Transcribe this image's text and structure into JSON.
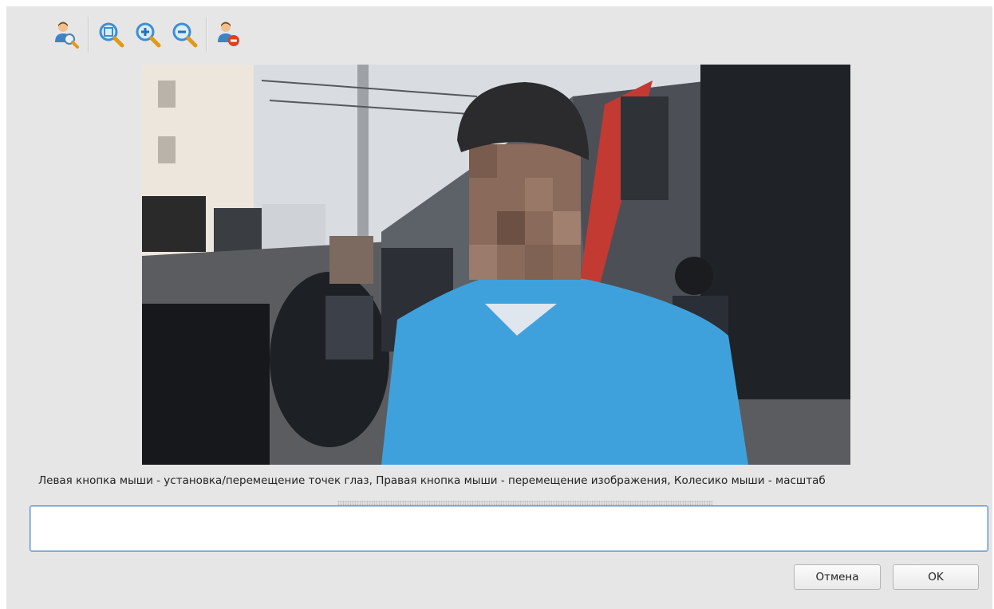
{
  "toolbar": {
    "buttons": [
      {
        "icon": "person-search-icon",
        "tooltip": ""
      },
      {
        "icon": "zoom-fit-icon",
        "tooltip": ""
      },
      {
        "icon": "zoom-in-icon",
        "tooltip": ""
      },
      {
        "icon": "zoom-out-icon",
        "tooltip": ""
      },
      {
        "icon": "person-remove-icon",
        "tooltip": ""
      }
    ]
  },
  "photo": {
    "description_icon": "photo-preview"
  },
  "hint_text": "Левая кнопка мыши - установка/перемещение точек глаз, Правая кнопка мыши - перемещение изображения, Колесико мыши - масштаб",
  "input": {
    "value": "",
    "placeholder": ""
  },
  "buttons": {
    "cancel": "Отмена",
    "ok": "OK"
  },
  "colors": {
    "dialog_bg": "#e6e6e6",
    "input_border": "#5d8fc8",
    "icon_magnifier": "#3e8ed0",
    "icon_handle": "#e09a1a",
    "icon_remove": "#e0401c"
  }
}
